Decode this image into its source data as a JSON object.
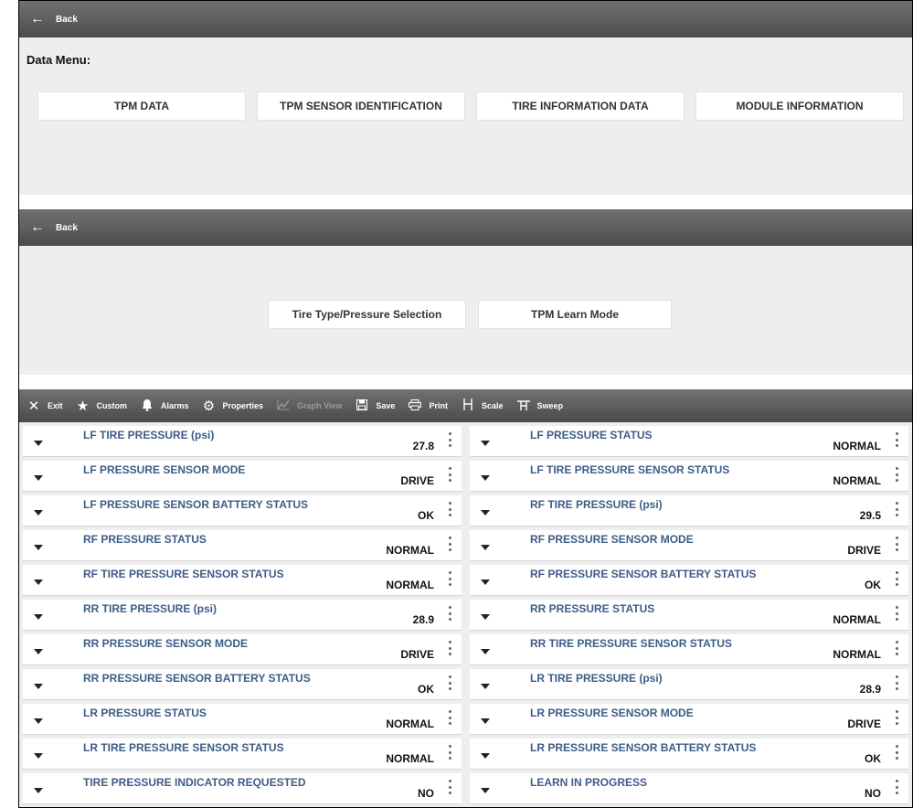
{
  "screen1": {
    "back_label": "Back",
    "title": "Data Menu:",
    "buttons": [
      "TPM DATA",
      "TPM SENSOR IDENTIFICATION",
      "TIRE INFORMATION DATA",
      "MODULE INFORMATION"
    ]
  },
  "screen2": {
    "back_label": "Back",
    "buttons": [
      "Tire Type/Pressure Selection",
      "TPM Learn Mode"
    ]
  },
  "toolbar": {
    "items": [
      {
        "label": "Exit",
        "icon": "close-icon",
        "enabled": true
      },
      {
        "label": "Custom",
        "icon": "star-icon",
        "enabled": true
      },
      {
        "label": "Alarms",
        "icon": "bell-icon",
        "enabled": true
      },
      {
        "label": "Properties",
        "icon": "gears-icon",
        "enabled": true
      },
      {
        "label": "Graph View",
        "icon": "graph-icon",
        "enabled": false
      },
      {
        "label": "Save",
        "icon": "floppy-icon",
        "enabled": true
      },
      {
        "label": "Print",
        "icon": "printer-icon",
        "enabled": true
      },
      {
        "label": "Scale",
        "icon": "scale-icon",
        "enabled": true
      },
      {
        "label": "Sweep",
        "icon": "sweep-icon",
        "enabled": true
      }
    ]
  },
  "pids": {
    "left": [
      {
        "name": "LF TIRE PRESSURE (psi)",
        "value": "27.8"
      },
      {
        "name": "LF PRESSURE SENSOR MODE",
        "value": "DRIVE"
      },
      {
        "name": "LF PRESSURE SENSOR BATTERY STATUS",
        "value": "OK"
      },
      {
        "name": "RF PRESSURE STATUS",
        "value": "NORMAL"
      },
      {
        "name": "RF TIRE PRESSURE SENSOR STATUS",
        "value": "NORMAL"
      },
      {
        "name": "RR TIRE PRESSURE (psi)",
        "value": "28.9"
      },
      {
        "name": "RR PRESSURE SENSOR MODE",
        "value": "DRIVE"
      },
      {
        "name": "RR PRESSURE SENSOR BATTERY STATUS",
        "value": "OK"
      },
      {
        "name": "LR PRESSURE STATUS",
        "value": "NORMAL"
      },
      {
        "name": "LR TIRE PRESSURE SENSOR STATUS",
        "value": "NORMAL"
      },
      {
        "name": "TIRE PRESSURE INDICATOR REQUESTED",
        "value": "NO"
      }
    ],
    "right": [
      {
        "name": "LF PRESSURE STATUS",
        "value": "NORMAL"
      },
      {
        "name": "LF TIRE PRESSURE SENSOR STATUS",
        "value": "NORMAL"
      },
      {
        "name": "RF TIRE PRESSURE (psi)",
        "value": "29.5"
      },
      {
        "name": "RF PRESSURE SENSOR MODE",
        "value": "DRIVE"
      },
      {
        "name": "RF PRESSURE SENSOR BATTERY STATUS",
        "value": "OK"
      },
      {
        "name": "RR PRESSURE STATUS",
        "value": "NORMAL"
      },
      {
        "name": "RR TIRE PRESSURE SENSOR STATUS",
        "value": "NORMAL"
      },
      {
        "name": "LR TIRE PRESSURE (psi)",
        "value": "28.9"
      },
      {
        "name": "LR PRESSURE SENSOR MODE",
        "value": "DRIVE"
      },
      {
        "name": "LR PRESSURE SENSOR BATTERY STATUS",
        "value": "OK"
      },
      {
        "name": "LEARN IN PROGRESS",
        "value": "NO"
      }
    ]
  }
}
